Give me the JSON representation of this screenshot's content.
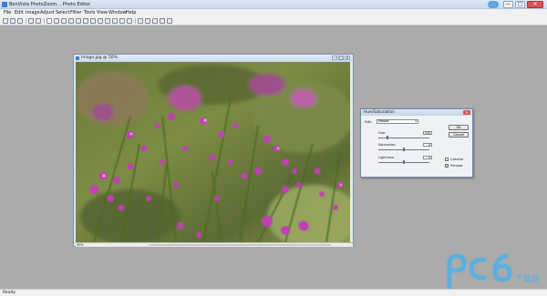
{
  "window": {
    "title": "BenVista PhotoZoom... Photo Editor",
    "controls": [
      "—",
      "□",
      "✕"
    ]
  },
  "menu": [
    "File",
    "Edit",
    "Image",
    "Adjust",
    "Select",
    "Filter",
    "Tools",
    "View",
    "Window",
    "Help"
  ],
  "document": {
    "title": "Image.jpg @ 50%",
    "zoom": "50%"
  },
  "dialog": {
    "title": "Hue/Saturation",
    "edit_label": "Edit:",
    "edit_value": "Master",
    "hue_label": "Hue:",
    "hue_value": "-130",
    "saturation_label": "Saturation:",
    "saturation_value": "0",
    "lightness_label": "Lightness:",
    "lightness_value": "0",
    "ok_label": "OK",
    "cancel_label": "Cancel",
    "colorize_label": "Colorize",
    "preview_label": "Preview",
    "preview_checked": "✓"
  },
  "status": {
    "text": "Ready"
  },
  "watermark": {
    "brand": "pc6",
    "cn_text": "下载站"
  },
  "colors": {
    "workspace": "#ababab",
    "accent": "#3d7fd0",
    "watermark": "#4fb0e8"
  }
}
